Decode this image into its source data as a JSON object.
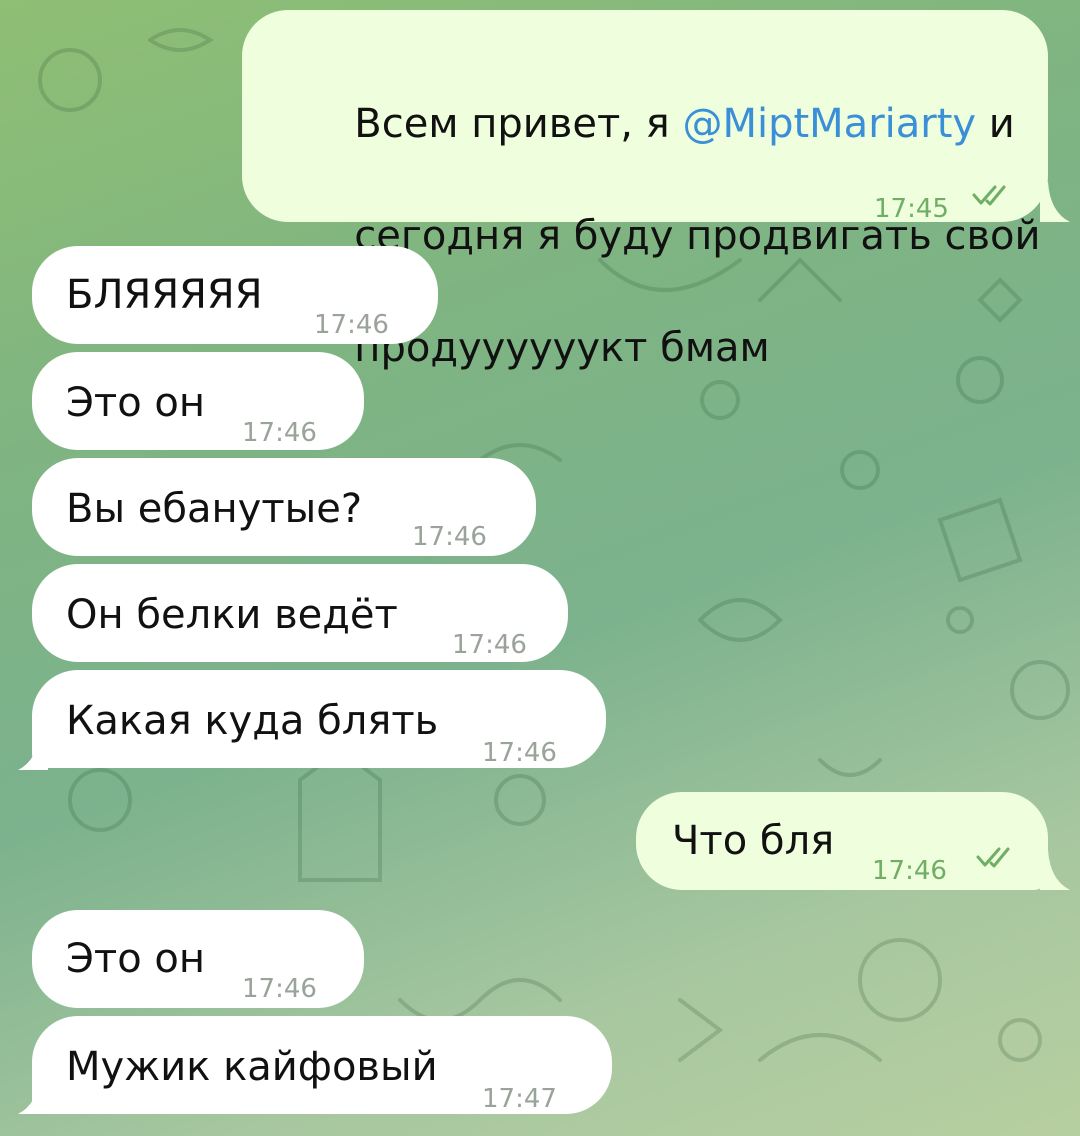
{
  "messages": [
    {
      "direction": "outgoing",
      "line1_before": "Всем привет, я ",
      "mention": "@MiptMariarty",
      "line1_after": " и",
      "line2": "сегодня я буду продвигать свой",
      "line3": "продуууууукт бмам",
      "time": "17:45",
      "status": "read"
    },
    {
      "direction": "incoming",
      "text": "БЛЯЯЯЯЯ",
      "time": "17:46"
    },
    {
      "direction": "incoming",
      "text": "Это он",
      "time": "17:46"
    },
    {
      "direction": "incoming",
      "text": "Вы ебанутые?",
      "time": "17:46"
    },
    {
      "direction": "incoming",
      "text": "Он белки ведёт",
      "time": "17:46"
    },
    {
      "direction": "incoming",
      "text": "Какая куда блять",
      "time": "17:46"
    },
    {
      "direction": "outgoing",
      "text": "Что бля",
      "time": "17:46",
      "status": "read"
    },
    {
      "direction": "incoming",
      "text": "Это он",
      "time": "17:46"
    },
    {
      "direction": "incoming",
      "text": "Мужик кайфовый",
      "time": "17:47"
    }
  ],
  "colors": {
    "incoming_bubble": "#ffffff",
    "outgoing_bubble": "#effedd",
    "mention": "#3a8fd6",
    "outgoing_meta": "#6fae64",
    "incoming_meta": "#9aa39a"
  },
  "icons": {
    "read_status": "double-check-icon",
    "background": "doodle-pattern"
  }
}
